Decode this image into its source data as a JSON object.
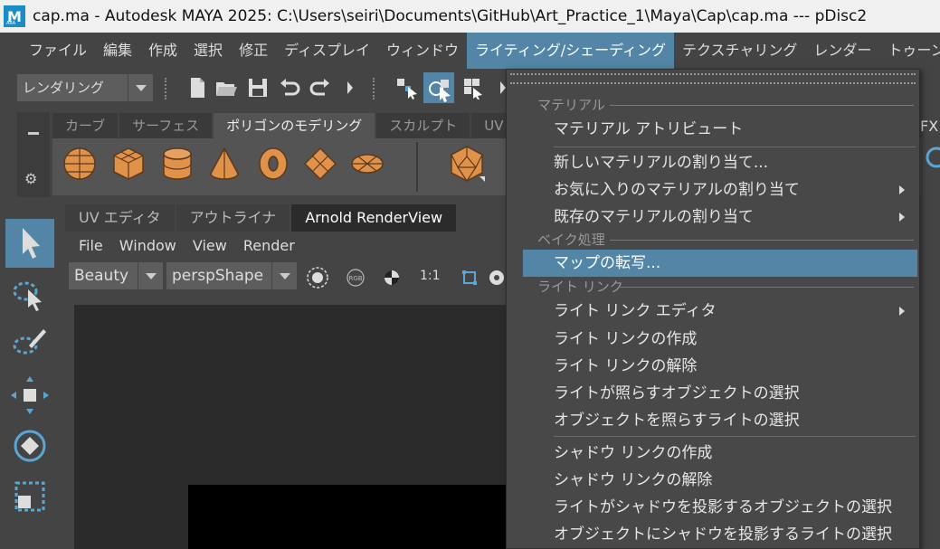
{
  "window": {
    "title": "cap.ma - Autodesk MAYA 2025: C:\\Users\\seiri\\Documents\\GitHub\\Art_Practice_1\\Maya\\Cap\\cap.ma   ---   pDisc2",
    "app_icon_letter": "M",
    "app_icon_sub": "ARA"
  },
  "menubar": {
    "items": [
      "ファイル",
      "編集",
      "作成",
      "選択",
      "修正",
      "ディスプレイ",
      "ウィンドウ",
      "ライティング/シェーディング",
      "テクスチャリング",
      "レンダー",
      "トゥーン"
    ],
    "active_index": 7
  },
  "toolbar": {
    "mode": "レンダリング"
  },
  "shelf": {
    "tabs": [
      "カーブ",
      "サーフェス",
      "ポリゴンのモデリング",
      "スカルプト",
      "UV"
    ],
    "active_tab": 2,
    "accent": "#e0924a"
  },
  "edge_label": "FX",
  "panel_tabs": [
    "UV エディタ",
    "アウトライナ",
    "Arnold RenderView"
  ],
  "renderview": {
    "menu": [
      "File",
      "Window",
      "View",
      "Render"
    ],
    "aov": "Beauty",
    "camera": "perspShape",
    "ratio_label": "1:1"
  },
  "dropdown": {
    "sections": {
      "material": "マテリアル",
      "bake": "ベイク処理",
      "light_link": "ライト リンク"
    },
    "items": {
      "material_attr": "マテリアル アトリビュート",
      "assign_new": "新しいマテリアルの割り当て...",
      "assign_fav": "お気に入りのマテリアルの割り当て",
      "assign_existing": "既存のマテリアルの割り当て",
      "transfer_maps": "マップの転写...",
      "link_editor": "ライト リンク エディタ",
      "make_link": "ライト リンクの作成",
      "break_link": "ライト リンクの解除",
      "select_objects_lit": "ライトが照らすオブジェクトの選択",
      "select_lights_illum": "オブジェクトを照らすライトの選択",
      "make_shadow_link": "シャドウ リンクの作成",
      "break_shadow_link": "シャドウ リンクの解除",
      "select_shadow_objects": "ライトがシャドウを投影するオブジェクトの選択",
      "select_shadow_lights": "オブジェクトにシャドウを投影するライトの選択"
    }
  },
  "colors": {
    "highlight": "#5285a6",
    "panel": "#444444",
    "viewport": "#2b2b2b"
  }
}
